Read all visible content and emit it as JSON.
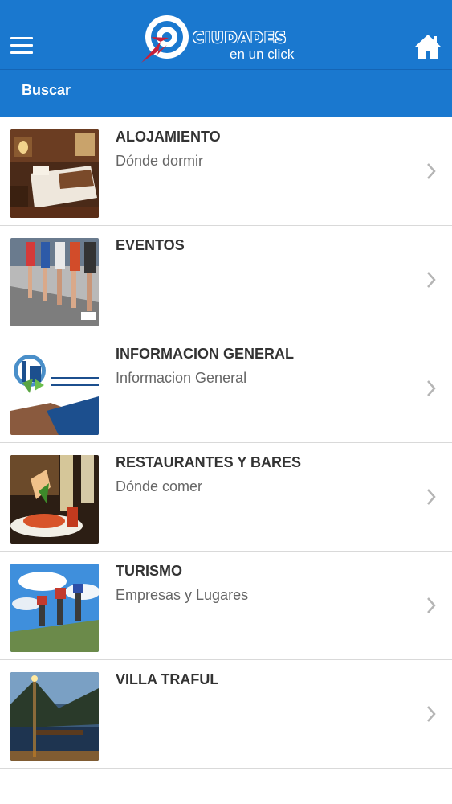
{
  "app": {
    "logo_title": "CIUDADES",
    "logo_subtitle": "en un click",
    "brand_color": "#1a78cf"
  },
  "header": {
    "menu_icon": "hamburger-menu-icon",
    "home_icon": "home-icon"
  },
  "search": {
    "label": "Buscar"
  },
  "categories": [
    {
      "title": "ALOJAMIENTO",
      "subtitle": "Dónde dormir",
      "image": "hotel-room-photo"
    },
    {
      "title": "EVENTOS",
      "subtitle": "",
      "image": "runners-photo"
    },
    {
      "title": "INFORMACION GENERAL",
      "subtitle": "Informacion General",
      "image": "informacion-general-photo"
    },
    {
      "title": "RESTAURANTES Y BARES",
      "subtitle": "Dónde comer",
      "image": "food-drinks-photo"
    },
    {
      "title": "TURISMO",
      "subtitle": "Empresas y Lugares",
      "image": "hikers-photo"
    },
    {
      "title": "VILLA TRAFUL",
      "subtitle": "",
      "image": "lake-pier-photo"
    }
  ]
}
